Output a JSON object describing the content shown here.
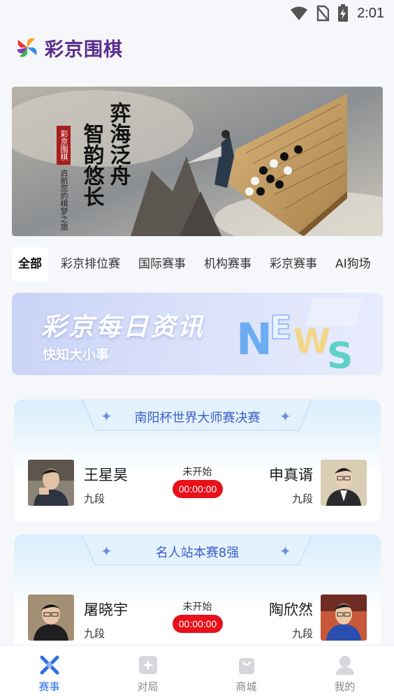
{
  "status_bar": {
    "time": "2:01"
  },
  "header": {
    "app_title": "彩京围棋"
  },
  "hero": {
    "line1": "弈海泛舟",
    "line2": "智韵悠长",
    "seal": "彩京围棋",
    "subtitle": "启航您的棋梦之旅"
  },
  "category_tabs": [
    {
      "label": "全部",
      "active": true
    },
    {
      "label": "彩京排位赛"
    },
    {
      "label": "国际赛事"
    },
    {
      "label": "机构赛事"
    },
    {
      "label": "彩京赛事"
    },
    {
      "label": "AI狗场"
    }
  ],
  "news_banner": {
    "title": "彩京每日资讯",
    "subtitle": "快知大小事",
    "art_text": "NEWS"
  },
  "matches": [
    {
      "title": "南阳杯世界大师赛决赛",
      "status": "未开始",
      "countdown": "00:00:00",
      "player_left": {
        "name": "王星昊",
        "rank": "九段"
      },
      "player_right": {
        "name": "申真谞",
        "rank": "九段"
      }
    },
    {
      "title": "名人站本赛8强",
      "status": "未开始",
      "countdown": "00:00:00",
      "player_left": {
        "name": "屠晓宇",
        "rank": "九段"
      },
      "player_right": {
        "name": "陶欣然",
        "rank": "九段"
      }
    }
  ],
  "bottom_nav": [
    {
      "label": "赛事",
      "icon": "swords-icon",
      "active": true
    },
    {
      "label": "对局",
      "icon": "board-icon"
    },
    {
      "label": "商城",
      "icon": "shopping-bag-icon"
    },
    {
      "label": "我的",
      "icon": "profile-icon"
    }
  ],
  "colors": {
    "accent": "#2f6fe0",
    "brand": "#5a2d8c",
    "countdown": "#e8101a",
    "card_title": "#3a5fc8"
  }
}
